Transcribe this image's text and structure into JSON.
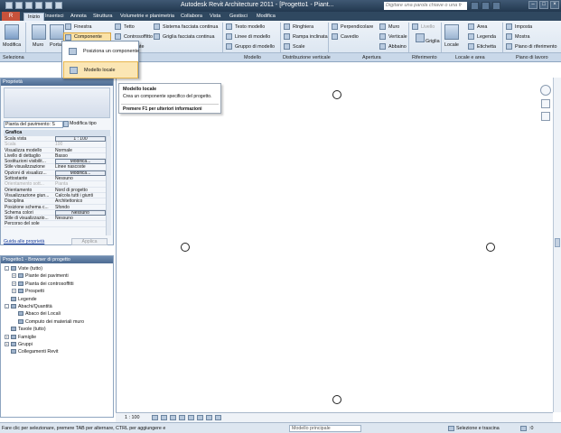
{
  "window": {
    "title": "Autodesk Revit Architecture 2011 -  [Progetto1 - Piant...",
    "search_placeholder": "Digitare una parola chiave o una fr"
  },
  "tabs": [
    "Inizio",
    "Inserisci",
    "Annota",
    "Struttura",
    "Volumetrie e planimetria",
    "Collabora",
    "Vista",
    "Gestisci",
    "Modifica"
  ],
  "ribbon": {
    "modifica": "Modifica",
    "muro": "Muro",
    "porta": "Porta",
    "finestra": "Finestra",
    "componente": "Componente",
    "tetto": "Tetto",
    "controsoffitto": "Controsoffitto",
    "montante": "Montante",
    "sistema_facciata": "Sistema facciata continua",
    "griglia_facciata": "Griglia facciata continua",
    "testo_modello": "Testo modello",
    "linee_modello": "Linee di modello",
    "gruppo_modello": "Gruppo di modello",
    "ringhiera": "Ringhiera",
    "rampa_inclinata": "Rampa inclinata",
    "scale": "Scale",
    "perpendicolare": "Perpendicolare",
    "cavedio": "Cavedio",
    "muro2": "Muro",
    "verticale": "Verticale",
    "abbaino": "Abbaino",
    "livello": "Livello",
    "griglia": "Griglia",
    "locale": "Locale",
    "area": "Area",
    "legenda": "Legenda",
    "etichetta": "Etichetta",
    "imposta": "Imposta",
    "mostra": "Mostra",
    "piano_riferimento": "Piano di riferimento"
  },
  "panels": [
    "Seleziona",
    "Modello",
    "Distribuzione verticale",
    "Apertura",
    "Riferimento",
    "Locale e area",
    "Piano di lavoro"
  ],
  "dropdown": {
    "item1": "Posiziona un componente",
    "item2": "Modello locale"
  },
  "tooltip": {
    "title": "Modello locale",
    "desc": "Crea un componente specifico del progetto.",
    "help": "Premere F1 per ulteriori informazioni"
  },
  "properties": {
    "header": "Proprietà",
    "type_selector": "Pianta del pavimento: S",
    "edit_type": "Modifica tipo",
    "category": "Grafica",
    "rows": [
      {
        "k": "Scala vista",
        "v": "1 : 100",
        "box": true,
        "dim": false
      },
      {
        "k": "Scala",
        "v": "100",
        "box": false,
        "dim": true
      },
      {
        "k": "Visualizza modello",
        "v": "Normale",
        "box": false,
        "dim": false
      },
      {
        "k": "Livello di dettaglio",
        "v": "Basso",
        "box": false,
        "dim": false
      },
      {
        "k": "Sostituzioni visibilit...",
        "v": "Modifica...",
        "box": true,
        "dim": false
      },
      {
        "k": "Stile visualizzazione",
        "v": "Linee nascoste",
        "box": false,
        "dim": false
      },
      {
        "k": "Opzioni di visualizz...",
        "v": "Modifica...",
        "box": true,
        "dim": false
      },
      {
        "k": "Sottostante",
        "v": "Nessuno",
        "box": false,
        "dim": false
      },
      {
        "k": "Orientamento sott...",
        "v": "Pianta",
        "box": false,
        "dim": true
      },
      {
        "k": "Orientamento",
        "v": "Nord di progetto",
        "box": false,
        "dim": false
      },
      {
        "k": "Visualizzazione giun...",
        "v": "Calcola tutti i giunti",
        "box": false,
        "dim": false
      },
      {
        "k": "Disciplina",
        "v": "Architettonico",
        "box": false,
        "dim": false
      },
      {
        "k": "Posizione schema c...",
        "v": "Sfondo",
        "box": false,
        "dim": false
      },
      {
        "k": "Schema colori",
        "v": "Nessuno",
        "box": true,
        "dim": false
      },
      {
        "k": "Stile di visualizzazio...",
        "v": "Nessuno",
        "box": false,
        "dim": false
      },
      {
        "k": "Percorso del sole",
        "v": "",
        "box": false,
        "dim": false
      }
    ],
    "help_link": "Guida alle proprietà",
    "apply": "Applica"
  },
  "browser": {
    "header": "Progetto1 - Browser di progetto",
    "nodes": [
      {
        "label": "Viste (tutto)",
        "level": 0,
        "toggle": "-"
      },
      {
        "label": "Piante dei pavimenti",
        "level": 1,
        "toggle": "+"
      },
      {
        "label": "Pianta dei controsoffitti",
        "level": 1,
        "toggle": "+"
      },
      {
        "label": "Prospetti",
        "level": 1,
        "toggle": "+"
      },
      {
        "label": "Legende",
        "level": 0,
        "toggle": ""
      },
      {
        "label": "Abachi/Quantità",
        "level": 0,
        "toggle": "-"
      },
      {
        "label": "Abaco dei Locali",
        "level": 1,
        "toggle": ""
      },
      {
        "label": "Computo dei materiali muro",
        "level": 1,
        "toggle": ""
      },
      {
        "label": "Tavole (tutto)",
        "level": 0,
        "toggle": ""
      },
      {
        "label": "Famiglie",
        "level": 0,
        "toggle": "+"
      },
      {
        "label": "Gruppi",
        "level": 0,
        "toggle": "+"
      },
      {
        "label": "Collegamenti Revit",
        "level": 0,
        "toggle": ""
      }
    ]
  },
  "viewbar": {
    "scale": "1 : 100"
  },
  "statusbar": {
    "hint": "Fare clic per selezionare, premere TAB per alternare, CTRL per aggiungere e",
    "model": "Modello principale",
    "select_drag": "Selezione e trascina",
    "filter_count": ":0"
  }
}
